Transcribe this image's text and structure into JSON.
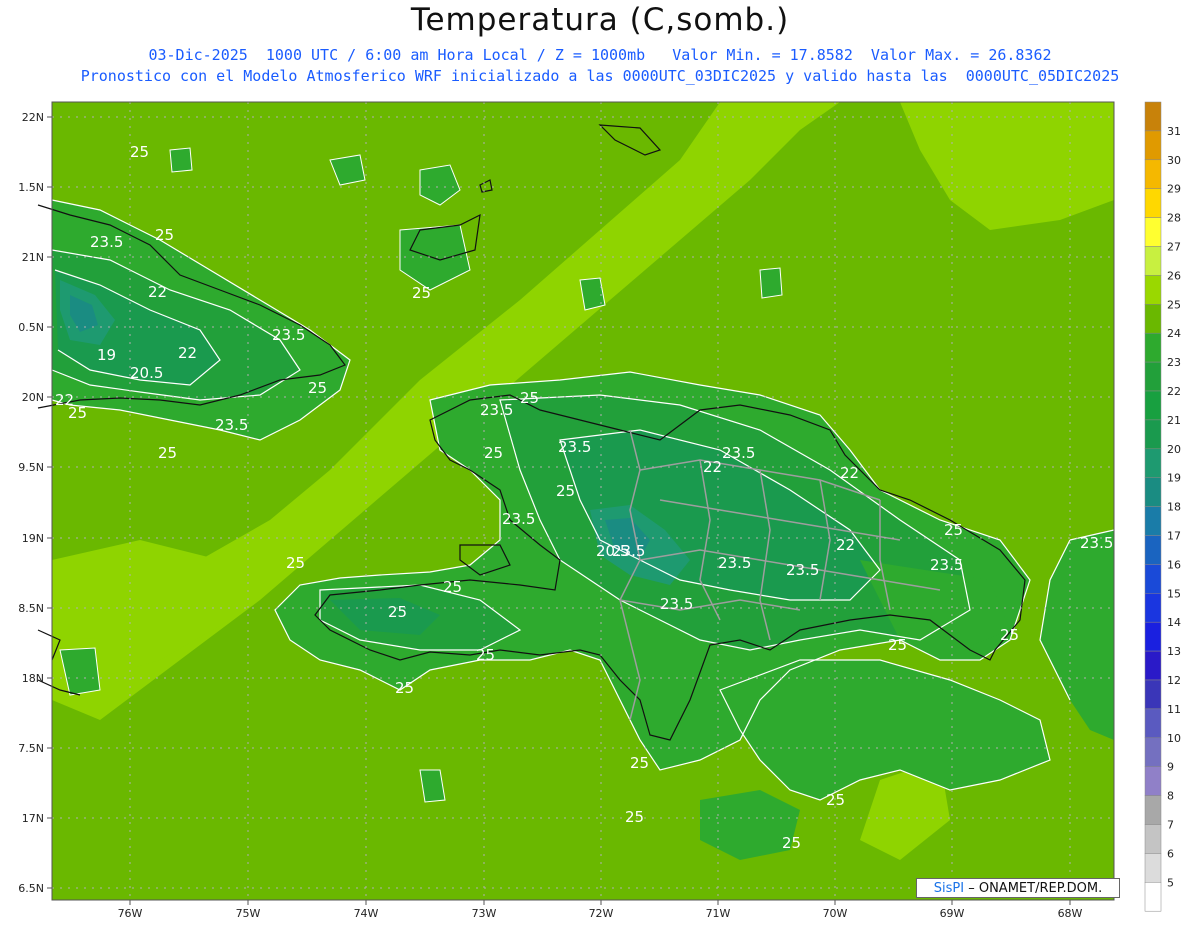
{
  "title": "Temperatura (C,somb.)",
  "subtitle_line1": "03-Dic-2025  1000 UTC / 6:00 am Hora Local / Z = 1000mb   Valor Min. = 17.8582  Valor Max. = 26.8362",
  "subtitle_line2": "Pronostico con el Modelo Atmosferico WRF inicializado a las 0000UTC_03DIC2025 y valido hasta las  0000UTC_05DIC2025",
  "credit": {
    "brand": "SisPI",
    "text": " – ONAMET/REP.DOM."
  },
  "x_ticks": [
    "76W",
    "75W",
    "74W",
    "73W",
    "72W",
    "71W",
    "70W",
    "69W",
    "68W"
  ],
  "y_ticks": [
    "22N",
    "1.5N",
    "21N",
    "0.5N",
    "20N",
    "9.5N",
    "19N",
    "8.5N",
    "18N",
    "7.5N",
    "17N",
    "6.5N"
  ],
  "colorbar": {
    "labels": [
      "31",
      "30",
      "29",
      "28",
      "27",
      "26",
      "25",
      "24",
      "23",
      "22",
      "21",
      "20",
      "19",
      "18",
      "17",
      "16",
      "15",
      "14",
      "13",
      "12",
      "11",
      "10",
      "9",
      "8",
      "7",
      "6",
      "5"
    ],
    "colors": [
      "#c8820a",
      "#e09a00",
      "#f5b800",
      "#ffd800",
      "#ffff30",
      "#c8f040",
      "#9ad800",
      "#6ab800",
      "#2eaa2e",
      "#22a03a",
      "#18a040",
      "#1a9a4e",
      "#1e9a70",
      "#1a8c82",
      "#1a7ca8",
      "#1a64c0",
      "#1a4ad8",
      "#1a36e0",
      "#1a20e0",
      "#2a1ac8",
      "#3a36b8",
      "#5a5ac0",
      "#7470c0",
      "#9080c8",
      "#a8a8a8",
      "#c4c4c4",
      "#dcdcdc",
      "#ffffff"
    ]
  },
  "contour_labels": [
    {
      "t": "25"
    },
    {
      "t": "23.5"
    },
    {
      "t": "25"
    },
    {
      "t": "22"
    },
    {
      "t": "23.5"
    },
    {
      "t": "19"
    },
    {
      "t": "22"
    },
    {
      "t": "20.5"
    },
    {
      "t": "25"
    },
    {
      "t": "22"
    },
    {
      "t": "25"
    },
    {
      "t": "23.5"
    },
    {
      "t": "25"
    },
    {
      "t": "25"
    },
    {
      "t": "23.5"
    },
    {
      "t": "25"
    },
    {
      "t": "23.5"
    },
    {
      "t": "25"
    },
    {
      "t": "25"
    },
    {
      "t": "23.5"
    },
    {
      "t": "22"
    },
    {
      "t": "23.5"
    },
    {
      "t": "22"
    },
    {
      "t": "23.5"
    },
    {
      "t": "20.5"
    },
    {
      "t": "23.5"
    },
    {
      "t": "23.5"
    },
    {
      "t": "22"
    },
    {
      "t": "23.5"
    },
    {
      "t": "25"
    },
    {
      "t": "25"
    },
    {
      "t": "25"
    },
    {
      "t": "23.5"
    },
    {
      "t": "25"
    },
    {
      "t": "25"
    },
    {
      "t": "25"
    },
    {
      "t": "23.5"
    },
    {
      "t": "25"
    },
    {
      "t": "25"
    },
    {
      "t": "25"
    },
    {
      "t": "25"
    },
    {
      "t": "25"
    },
    {
      "t": "25"
    }
  ]
}
